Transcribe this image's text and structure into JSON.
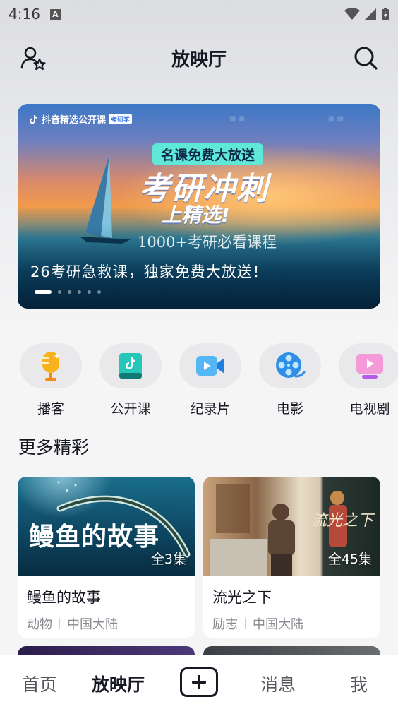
{
  "status_bar": {
    "time": "4:16",
    "notification_letter": "A"
  },
  "header": {
    "title": "放映厅"
  },
  "banner": {
    "brand": "抖音精选公开课",
    "brand_tag": "考研季",
    "pill": "名课免费大放送",
    "headline": "考研冲刺",
    "subheadline": "上精选!",
    "small_text": "1000+考研必看课程",
    "caption": "26考研急救课，独家免费大放送！",
    "slide_count": 6,
    "active_slide": 1
  },
  "categories": [
    {
      "label": "播客",
      "icon": "podcast-mic-icon"
    },
    {
      "label": "公开课",
      "icon": "open-course-book-icon"
    },
    {
      "label": "纪录片",
      "icon": "documentary-camera-icon"
    },
    {
      "label": "电影",
      "icon": "film-reel-icon"
    },
    {
      "label": "电视剧",
      "icon": "tv-series-icon"
    }
  ],
  "section": {
    "title": "更多精彩"
  },
  "cards": [
    {
      "title": "鳗鱼的故事",
      "poster_title": "鳗鱼的故事",
      "episodes": "全3集",
      "tag1": "动物",
      "tag2": "中国大陆"
    },
    {
      "title": "流光之下",
      "poster_title": "流光之下",
      "episodes": "全45集",
      "tag1": "励志",
      "tag2": "中国大陆"
    }
  ],
  "bottom_nav": {
    "home": "首页",
    "theater": "放映厅",
    "messages": "消息",
    "me": "我"
  }
}
